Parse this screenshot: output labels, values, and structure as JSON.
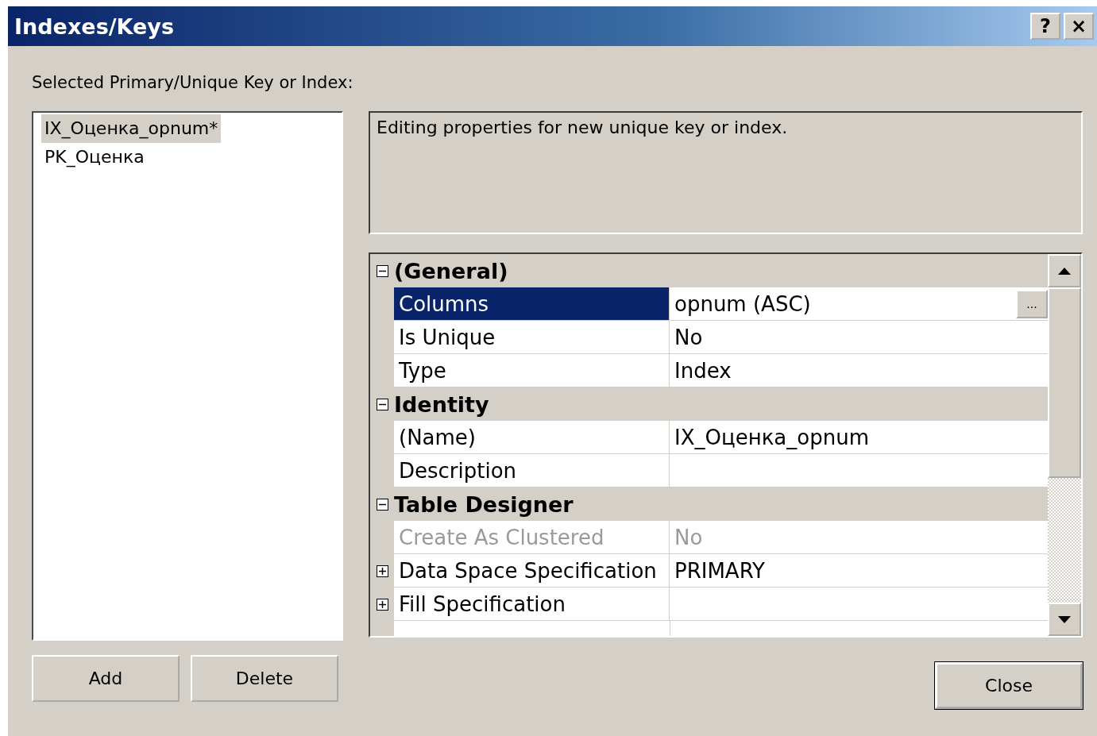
{
  "window": {
    "title": "Indexes/Keys",
    "help_button": "?",
    "close_button": "×"
  },
  "list_label": "Selected Primary/Unique Key or Index:",
  "items": [
    {
      "label": "IX_Оценка_opnum*",
      "selected": true
    },
    {
      "label": "PK_Оценка",
      "selected": false
    }
  ],
  "description": "Editing properties for new unique key or index.",
  "property_grid": {
    "categories": [
      {
        "name": "(General)",
        "expanded": true,
        "properties": [
          {
            "name": "Columns",
            "value": "opnum (ASC)",
            "kind": "plain",
            "selected": true,
            "disabled": false,
            "editor_button": "..."
          },
          {
            "name": "Is Unique",
            "value": "No",
            "kind": "plain",
            "selected": false,
            "disabled": false
          },
          {
            "name": "Type",
            "value": "Index",
            "kind": "plain",
            "selected": false,
            "disabled": false
          }
        ]
      },
      {
        "name": "Identity",
        "expanded": true,
        "properties": [
          {
            "name": "(Name)",
            "value": "IX_Оценка_opnum",
            "kind": "plain",
            "selected": false,
            "disabled": false
          },
          {
            "name": "Description",
            "kind": "plain",
            "selected": false,
            "disabled": false
          }
        ]
      },
      {
        "name": "Table Designer",
        "expanded": true,
        "properties": [
          {
            "name": "Create As Clustered",
            "value": "No",
            "kind": "plain",
            "selected": false,
            "disabled": true
          },
          {
            "name": "Data Space Specification",
            "value": "PRIMARY",
            "kind": "expandable",
            "expanded": false,
            "selected": false,
            "disabled": false
          },
          {
            "name": "Fill Specification",
            "kind": "expandable",
            "expanded": false,
            "selected": false,
            "disabled": false
          }
        ]
      }
    ]
  },
  "buttons": [
    {
      "label": "Add",
      "default": false
    },
    {
      "label": "Delete",
      "default": false
    }
  ],
  "close_button": {
    "label": "Close",
    "default": true
  }
}
